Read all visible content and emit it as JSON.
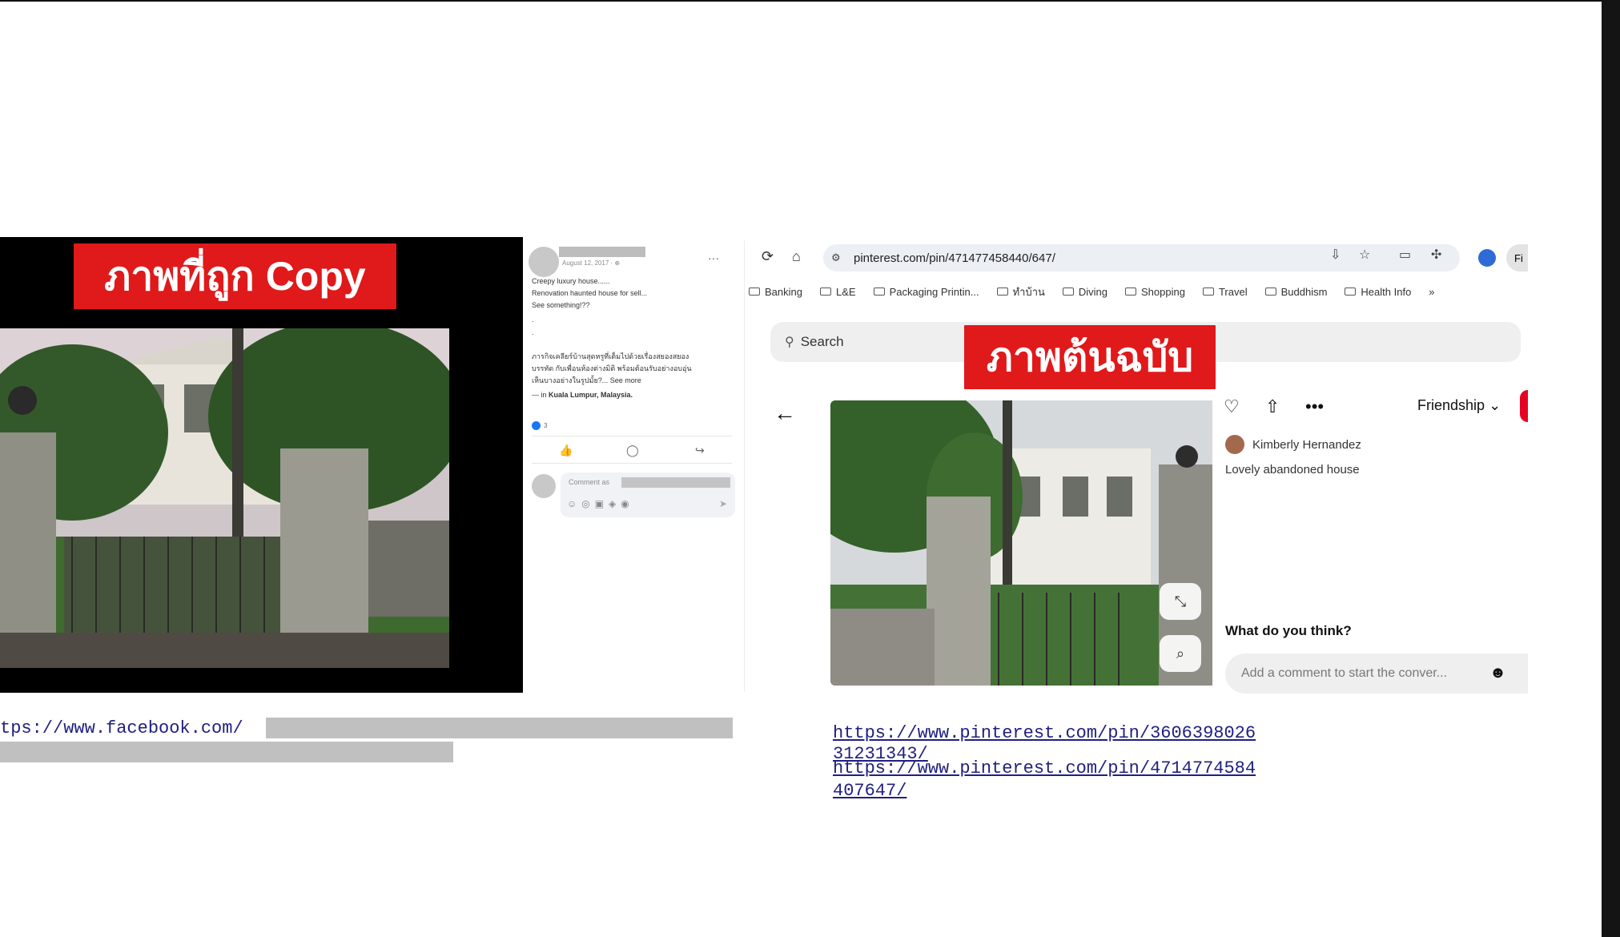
{
  "left_slide": {
    "banner": "ภาพที่ถูก Copy"
  },
  "fb_post": {
    "date": "August 12, 2017 · ⊕",
    "more": "···",
    "lines": [
      "Creepy luxury house......",
      "Renovation haunted house for sell...",
      "See something!??",
      ".",
      ".",
      "ภารกิจเคลียร์บ้านสุดหรูที่เต็มไปด้วยเรื่องสยองสยอง",
      "บรรทัด กับเพื่อนห้องต่างมิติ พร้อมต้อนรับอย่างอบอุ่น",
      "เห็นบางอย่างในรูปมั้ย?... See more"
    ],
    "location_prefix": "— in ",
    "location": "Kuala Lumpur, Malaysia.",
    "like_count": "3",
    "comment_placeholder": "Comment as"
  },
  "browser": {
    "url": "pinterest.com/pin/471477458440/647/",
    "profile_label": "Fi",
    "bookmarks": [
      "Banking",
      "L&E",
      "Packaging Printin...",
      "ทำบ้าน",
      "Diving",
      "Shopping",
      "Travel",
      "Buddhism",
      "Health Info"
    ],
    "bookmarks_overflow": "»"
  },
  "pinterest": {
    "search_label": "Search",
    "banner": "ภาพต้นฉบับ",
    "board": "Friendship",
    "user": "Kimberly Hernandez",
    "description": "Lovely abandoned house",
    "question": "What do you think?",
    "comment_placeholder": "Add a comment to start the conver..."
  },
  "links": {
    "fb_url": "tps://www.facebook.com/",
    "pin_url_1a": "https://www.pinterest.com/pin/3606398026",
    "pin_url_1b": "31231343/",
    "pin_url_2a": "https://www.pinterest.com/pin/4714774584",
    "pin_url_2b": "407647/"
  },
  "icons": {
    "reload": "reload-icon",
    "home": "home-icon",
    "star": "star-icon",
    "like": "thumbs-up-icon",
    "comment": "comment-icon",
    "share": "share-icon",
    "heart": "heart-icon",
    "upload": "upload-icon",
    "ellipsis": "ellipsis-icon",
    "back": "arrow-left-icon",
    "expand": "expand-icon",
    "lens": "visual-search-icon",
    "emoji": "emoji-icon"
  },
  "colors": {
    "banner_red": "#e0191b",
    "pinterest_red": "#e60023",
    "fb_blue": "#1877f2"
  }
}
